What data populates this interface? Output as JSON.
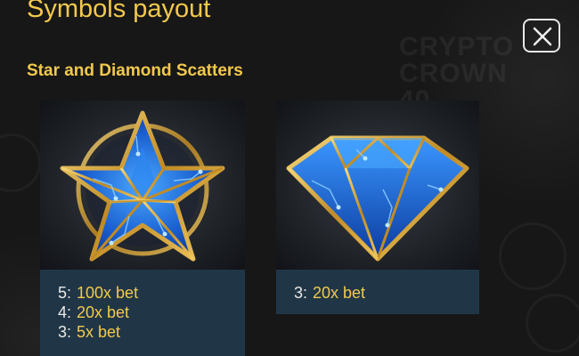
{
  "header": {
    "title": "Symbols payout",
    "close_icon": "close-x-icon"
  },
  "section": {
    "title": "Star and Diamond Scatters"
  },
  "background": {
    "logo_line1": "CRYPTO",
    "logo_line2": "CROWN",
    "logo_line3": "40"
  },
  "symbols": [
    {
      "name": "star-scatter",
      "icon": "blue-crystal-star-icon",
      "payouts": [
        {
          "count": "5:",
          "value": "100x bet"
        },
        {
          "count": "4:",
          "value": "20x bet"
        },
        {
          "count": "3:",
          "value": "5x bet"
        }
      ]
    },
    {
      "name": "diamond-scatter",
      "icon": "blue-crystal-diamond-icon",
      "payouts": [
        {
          "count": "3:",
          "value": "20x bet"
        }
      ]
    }
  ],
  "colors": {
    "accent": "#f2c94c",
    "card_bg": "#203647",
    "crystal_blue": "#1e6fe0",
    "gold": "#d4a23a"
  }
}
